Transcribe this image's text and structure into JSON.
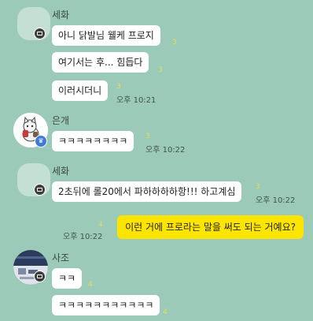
{
  "messages": {
    "sehwa1": {
      "name": "세화",
      "bubbles": [
        {
          "text": "아니 닭발님 웰케 프로지",
          "count": "3"
        },
        {
          "text": "여기서는 후... 힘듭다",
          "count": "3"
        },
        {
          "text": "이러시더니",
          "count": "3",
          "time": "오후 10:21"
        }
      ]
    },
    "eungae": {
      "name": "은개",
      "bubbles": [
        {
          "text": "ㅋㅋㅋㅋㅋㅋㅋㅋ",
          "count": "3",
          "time": "오후 10:22"
        }
      ]
    },
    "sehwa2": {
      "name": "세화",
      "bubbles": [
        {
          "text": "2초뒤에 롤20에서 파하하하하항!!! 하고계심",
          "count": "3",
          "time": "오후 10:22"
        }
      ]
    },
    "mine": {
      "text": "이런 거에 프로라는 말을 써도 되는 거예요?",
      "count": "4",
      "time": "오후 10:22"
    },
    "sajo": {
      "name": "사조",
      "bubbles": [
        {
          "text": "ㅋㅋ",
          "count": "4"
        },
        {
          "text": "ㅋㅋㅋㅋㅋㅋㅋㅋㅋㅋㅋ",
          "count": "4"
        }
      ]
    }
  },
  "colors": {
    "background": "#9bcbb8",
    "my_bubble": "#fee500",
    "unread_count": "#e8dc5c"
  }
}
